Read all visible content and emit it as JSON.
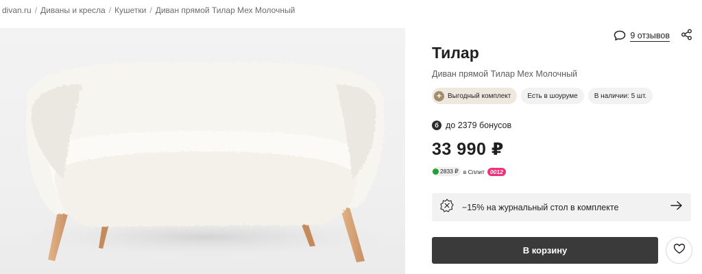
{
  "breadcrumb": [
    "divan.ru",
    "Диваны и кресла",
    "Кушетки",
    "Диван прямой Тилар Мех Молочный"
  ],
  "breadcrumb_separator": "/",
  "reviews": {
    "label": "9 отзывов",
    "icon": "comment-icon"
  },
  "share_icon": "share-icon",
  "product": {
    "title": "Тилар",
    "subtitle": "Диван прямой Тилар Мех Молочный",
    "badges": [
      "Выгодный комплект",
      "Есть в шоуруме",
      "В наличии: 5 шт."
    ],
    "badge_plus": "+",
    "bonus_icon_letter": "б",
    "bonus": "до 2379 бонусов",
    "price": "33 990 ₽"
  },
  "split": {
    "amount": "2833 ₽",
    "label": "в Сплит",
    "code": "0012"
  },
  "promo": {
    "text": "−15% на журнальный стол в комплекте",
    "icon": "table-icon",
    "arrow_icon": "arrow-right-icon"
  },
  "actions": {
    "cart_label": "В корзину",
    "favorite_icon": "heart-icon"
  },
  "colors": {
    "accent_dark": "#3a3a3a",
    "badge_combo": "#efe8df",
    "split_code": "#f0307a",
    "split_dot": "#21a038"
  }
}
